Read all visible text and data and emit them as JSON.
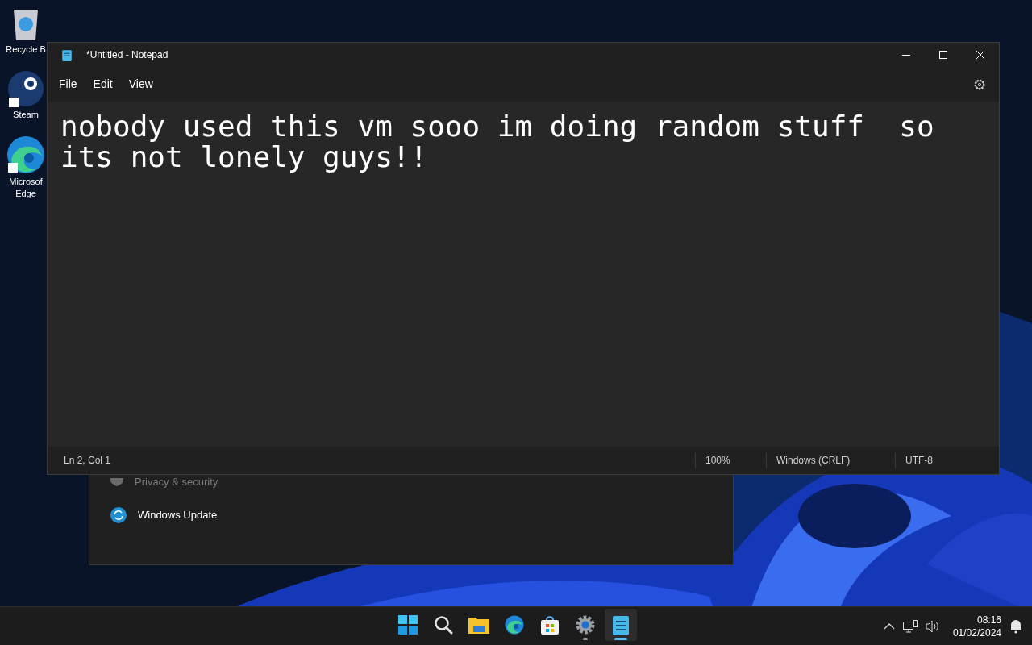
{
  "desktop_icons": [
    {
      "kind": "recycle",
      "lines": [
        "Recycle B"
      ]
    },
    {
      "kind": "steam",
      "lines": [
        "Steam"
      ]
    },
    {
      "kind": "edge",
      "lines": [
        "Microsof",
        "Edge"
      ]
    }
  ],
  "settings_window": {
    "nav_items": [
      {
        "kind": "privacy",
        "label": "Privacy & security",
        "dimmed": true
      },
      {
        "kind": "update",
        "label": "Windows Update",
        "dimmed": false
      }
    ]
  },
  "notepad": {
    "title": "*Untitled - Notepad",
    "menu": [
      "File",
      "Edit",
      "View"
    ],
    "text_lines": [
      "nobody used this vm sooo im doing random stuff  so",
      "its not lonely guys!!"
    ],
    "status_bar": [
      "Ln 2, Col 1",
      "100%",
      "Windows (CRLF)",
      "UTF-8"
    ]
  },
  "taskbar": {
    "apps": [
      {
        "kind": "start",
        "running": false,
        "active": false
      },
      {
        "kind": "search",
        "running": false,
        "active": false
      },
      {
        "kind": "explorer",
        "running": false,
        "active": false
      },
      {
        "kind": "edge",
        "running": false,
        "active": false
      },
      {
        "kind": "store",
        "running": false,
        "active": false
      },
      {
        "kind": "settings",
        "running": true,
        "active": false
      },
      {
        "kind": "notepad",
        "running": true,
        "active": true
      }
    ],
    "time": "08:16",
    "date": "01/02/2024"
  }
}
